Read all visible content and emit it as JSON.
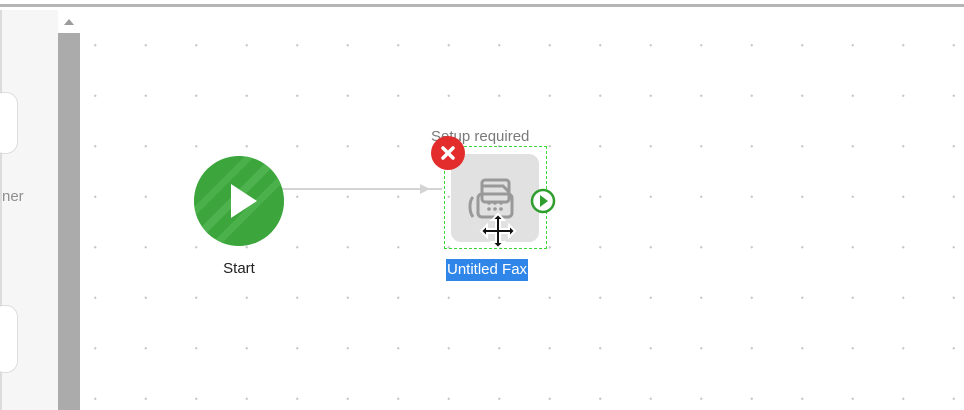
{
  "sidebar": {
    "partial_label": "ner"
  },
  "canvas": {
    "start_node": {
      "label": "Start",
      "icon": "play-icon",
      "color": "#3ca63c"
    },
    "fax_node": {
      "label": "Untitled Fax",
      "status_text": "Setup required",
      "icon": "fax-icon",
      "error_icon": "close-icon",
      "next_port_icon": "play-circle-icon",
      "selection_color": "#3bd83b",
      "label_highlight_color": "#2f86e8"
    }
  }
}
